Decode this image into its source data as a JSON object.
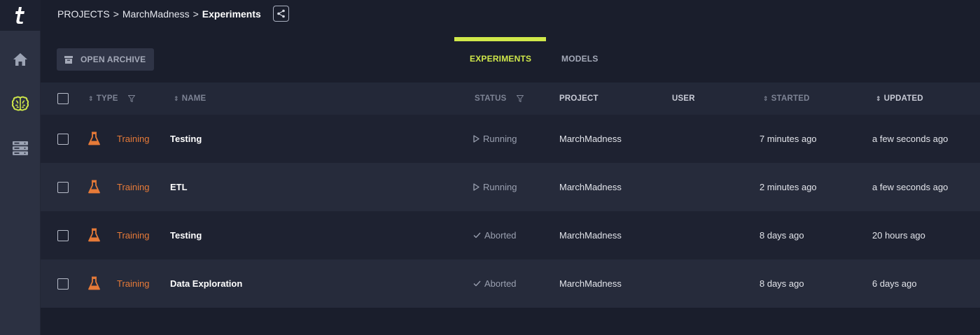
{
  "breadcrumb": {
    "root": "PROJECTS",
    "separator": ">",
    "project": "MarchMadness",
    "current": "Experiments"
  },
  "toolbar": {
    "archive_label": "OPEN ARCHIVE"
  },
  "tabs": [
    {
      "label": "EXPERIMENTS",
      "active": true
    },
    {
      "label": "MODELS",
      "active": false
    }
  ],
  "table": {
    "headers": {
      "type": "TYPE",
      "name": "NAME",
      "status": "STATUS",
      "project": "PROJECT",
      "user": "USER",
      "started": "STARTED",
      "updated": "UPDATED"
    },
    "rows": [
      {
        "type": "Training",
        "name": "Testing",
        "status": "Running",
        "status_icon": "play-icon",
        "project": "MarchMadness",
        "user": "",
        "started": "7 minutes ago",
        "updated": "a few seconds ago"
      },
      {
        "type": "Training",
        "name": "ETL",
        "status": "Running",
        "status_icon": "play-icon",
        "project": "MarchMadness",
        "user": "",
        "started": "2 minutes ago",
        "updated": "a few seconds ago"
      },
      {
        "type": "Training",
        "name": "Testing",
        "status": "Aborted",
        "status_icon": "check-icon",
        "project": "MarchMadness",
        "user": "",
        "started": "8 days ago",
        "updated": "20 hours ago"
      },
      {
        "type": "Training",
        "name": "Data Exploration",
        "status": "Aborted",
        "status_icon": "check-icon",
        "project": "MarchMadness",
        "user": "",
        "started": "8 days ago",
        "updated": "6 days ago"
      }
    ]
  },
  "colors": {
    "accent": "#d0e84a",
    "training": "#e67a38",
    "background": "#1a1e2c",
    "sidebar": "#2c3142"
  }
}
